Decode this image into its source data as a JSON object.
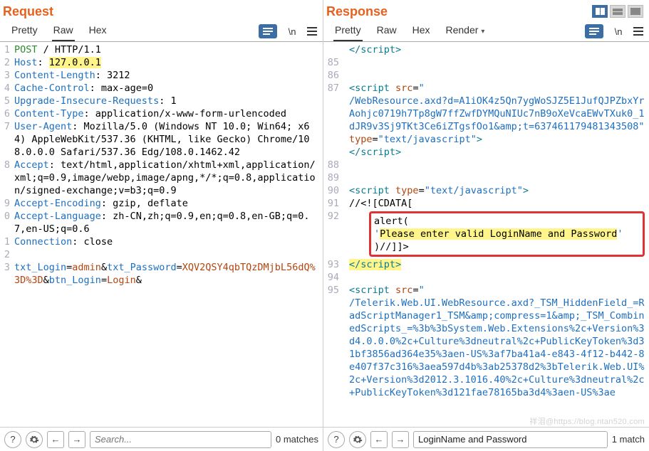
{
  "request": {
    "title": "Request",
    "tabs": [
      "Pretty",
      "Raw",
      "Hex"
    ],
    "active_tab": 1,
    "toolbar": {
      "wrap_label": "\\n"
    },
    "lines": [
      {
        "n": "1",
        "html": "<span class='hval'>POST</span> / HTTP/1.1"
      },
      {
        "n": "2",
        "html": "<span class='hname'>Host</span>: <span class='hl-y'>127.0.0.1</span>"
      },
      {
        "n": "3",
        "html": "<span class='hname'>Content-Length</span>: 3212"
      },
      {
        "n": "4",
        "html": "<span class='hname'>Cache-Control</span>: max-age=0"
      },
      {
        "n": "5",
        "html": "<span class='hname'>Upgrade-Insecure-Requests</span>: 1"
      },
      {
        "n": "6",
        "html": "<span class='hname'>Content-Type</span>: application/x-www-form-urlencoded"
      },
      {
        "n": "7",
        "html": "<span class='hname'>User-Agent</span>: Mozilla/5.0 (Windows NT 10.0; Win64; x64) AppleWebKit/537.36 (KHTML, like Gecko) Chrome/108.0.0.0 Safari/537.36 Edg/108.0.1462.42"
      },
      {
        "n": "8",
        "html": "<span class='hname'>Accept</span>: text/html,application/xhtml+xml,application/xml;q=0.9,image/webp,image/apng,*/*;q=0.8,application/signed-exchange;v=b3;q=0.9"
      },
      {
        "n": "9",
        "html": "<span class='hname'>Accept-Encoding</span>: gzip, deflate"
      },
      {
        "n": "0",
        "html": "<span class='hname'>Accept-Language</span>: zh-CN,zh;q=0.9,en;q=0.8,en-GB;q=0.7,en-US;q=0.6"
      },
      {
        "n": "1",
        "html": "<span class='hname'>Connection</span>: close"
      },
      {
        "n": "2",
        "html": "&nbsp;"
      },
      {
        "n": "3",
        "html": "<span class='hname'>txt_Login</span>=<span class='b-admin'>admin</span>&amp;<span class='hname'>txt_Password</span>=<span class='b-admin'>XQV2QSY4qbTQzDMjbL56dQ%3D%3D</span>&amp;<span class='hname'>btn_Login</span>=<span class='b-admin'>Login</span>&amp;"
      }
    ],
    "search": {
      "placeholder": "Search...",
      "value": "",
      "matches": "0 matches"
    }
  },
  "response": {
    "title": "Response",
    "tabs": [
      "Pretty",
      "Raw",
      "Hex",
      "Render"
    ],
    "active_tab": 0,
    "toolbar": {
      "wrap_label": "\\n"
    },
    "lines_top": [
      {
        "n": "",
        "html": "<span class='tagc'>&lt;/script&gt;</span>"
      },
      {
        "n": "85",
        "html": "&nbsp;"
      },
      {
        "n": "86",
        "html": "&nbsp;"
      },
      {
        "n": "87",
        "html": "<span class='tagc'>&lt;script</span> <span class='attr'>src</span>=<span class='str'>\"</span><br><span class='str'>/WebResource.axd?d=A1iOK4z5Qn7ygWoSJZ5E1JufQJPZbxYrAohjc0719h7Tp8gW7ffZwfDYMQuNIUc7nB9oXeVcaEWvTXuk0_1dJR9v3Sj9TKt3Ce6iZTgsfOo1&amp;amp;t=637461179481343508\"</span> <span class='attr'>type</span>=<span class='str'>\"text/javascript\"</span><span class='tagc'>&gt;</span><br><span class='tagc'>&lt;/script&gt;</span>"
      },
      {
        "n": "88",
        "html": "&nbsp;"
      },
      {
        "n": "89",
        "html": "&nbsp;"
      },
      {
        "n": "90",
        "html": "<span class='tagc'>&lt;script</span> <span class='attr'>type</span>=<span class='str'>\"text/javascript\"</span><span class='tagc'>&gt;</span>"
      },
      {
        "n": "91",
        "html": "//&lt;![CDATA["
      }
    ],
    "highlight_block": {
      "line_no": "92",
      "pre": "alert(",
      "msg_q1": "'",
      "msg": "Please enter valid LoginName and Password",
      "msg_q2": "'",
      "post": ")//]]>"
    },
    "lines_bottom": [
      {
        "n": "93",
        "html": "<span class='hl-y'><span class='tagc'>&lt;/script&gt;</span></span>"
      },
      {
        "n": "94",
        "html": "&nbsp;"
      },
      {
        "n": "95",
        "html": "<span class='tagc'>&lt;script</span> <span class='attr'>src</span>=<span class='str'>\"</span><br><span class='str'>/Telerik.Web.UI.WebResource.axd?_TSM_HiddenField_=RadScriptManager1_TSM&amp;amp;compress=1&amp;amp;_TSM_CombinedScripts_=%3b%3bSystem.Web.Extensions%2c+Version%3d4.0.0.0%2c+Culture%3dneutral%2c+PublicKeyToken%3d31bf3856ad364e35%3aen-US%3af7ba41a4-e843-4f12-b442-8e407f37c316%3aea597d4b%3ab25378d2%3bTelerik.Web.UI%2c+Version%3d2012.3.1016.40%2c+Culture%3dneutral%2c+PublicKeyToken%3d121fae78165ba3d4%3aen-US%3ae</span>"
      }
    ],
    "search": {
      "placeholder": "Search...",
      "value": "LoginName and Password",
      "matches": "1 match"
    }
  },
  "watermark": "祥泪@https://blog.ntan520.com"
}
